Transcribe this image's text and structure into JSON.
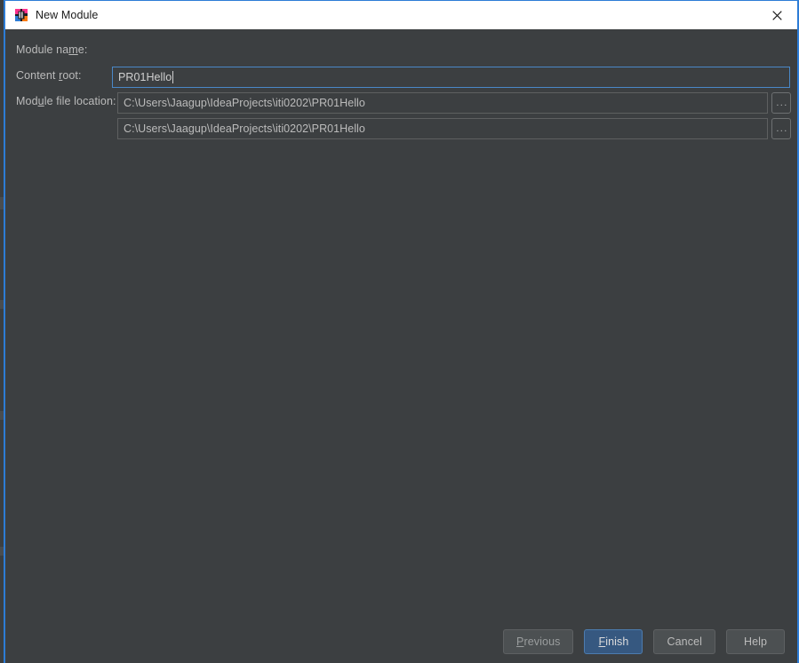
{
  "window": {
    "title": "New Module",
    "icon": "intellij-idea-icon",
    "close_icon": "close-icon",
    "accent_border_color": "#2d7cd6",
    "titlebar_background": "#ffffff",
    "body_background": "#3c3f41"
  },
  "form": {
    "rows": [
      {
        "label_before": "Module na",
        "label_mnemonic": "m",
        "label_after": "e:",
        "value": "PR01Hello",
        "focused": true,
        "has_browse": false,
        "browse_label": ""
      },
      {
        "label_before": "Content ",
        "label_mnemonic": "r",
        "label_after": "oot:",
        "value": "C:\\Users\\Jaagup\\IdeaProjects\\iti0202\\PR01Hello",
        "focused": false,
        "has_browse": true,
        "browse_label": "..."
      },
      {
        "label_before": "Mod",
        "label_mnemonic": "u",
        "label_after": "le file location:",
        "value": "C:\\Users\\Jaagup\\IdeaProjects\\iti0202\\PR01Hello",
        "focused": false,
        "has_browse": true,
        "browse_label": "..."
      }
    ]
  },
  "buttons": {
    "previous": {
      "before": "",
      "mnemonic": "P",
      "after": "revious"
    },
    "finish": {
      "before": "",
      "mnemonic": "F",
      "after": "inish",
      "default": true,
      "accent_color": "#365880"
    },
    "cancel": {
      "before": "Cancel",
      "mnemonic": "",
      "after": ""
    },
    "help": {
      "before": "Help",
      "mnemonic": "",
      "after": ""
    }
  }
}
